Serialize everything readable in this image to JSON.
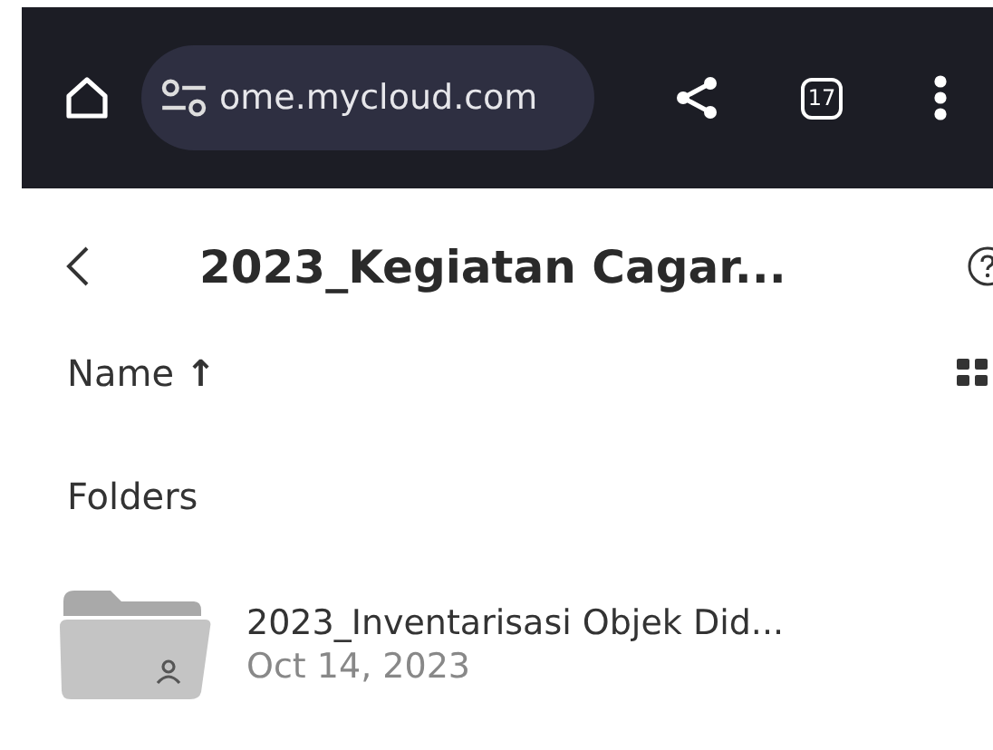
{
  "browser": {
    "url": "ome.mycloud.com",
    "tab_count": "17"
  },
  "header": {
    "title": "2023_Kegiatan Cagar..."
  },
  "sort": {
    "label": "Name",
    "arrow": "↑"
  },
  "section": "Folders",
  "folders": [
    {
      "name": "2023_Inventarisasi Objek Did...",
      "date": "Oct 14, 2023",
      "shared": true
    }
  ]
}
